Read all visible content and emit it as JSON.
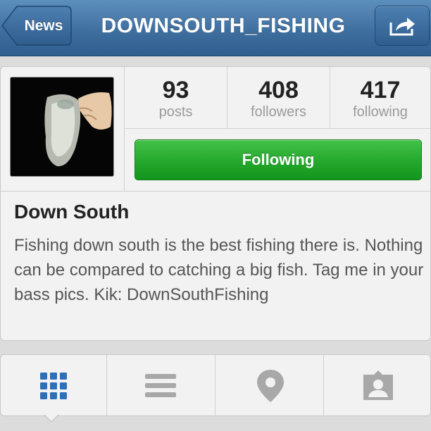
{
  "nav": {
    "back_label": "News",
    "title": "DOWNSOUTH_FISHING",
    "share_icon": "share-icon"
  },
  "profile": {
    "avatar_description_icon": "profile-photo",
    "stats": [
      {
        "value": "93",
        "label": "posts"
      },
      {
        "value": "408",
        "label": "followers"
      },
      {
        "value": "417",
        "label": "following"
      }
    ],
    "follow_button_label": "Following",
    "name": "Down South",
    "bio": "Fishing down south is the best fishing there is. Nothing can be compared to catching a big fish. Tag me in your bass pics. Kik: DownSouthFishing"
  },
  "tabs": [
    {
      "icon": "grid-icon",
      "active": true
    },
    {
      "icon": "list-icon",
      "active": false
    },
    {
      "icon": "map-pin-icon",
      "active": false
    },
    {
      "icon": "tagged-photos-icon",
      "active": false
    }
  ],
  "colors": {
    "nav_bar": "#3f6f9f",
    "follow_button": "#22a52a",
    "active_tab_icon": "#2f6fb8",
    "inactive_tab_icon": "#a8a8a8"
  }
}
